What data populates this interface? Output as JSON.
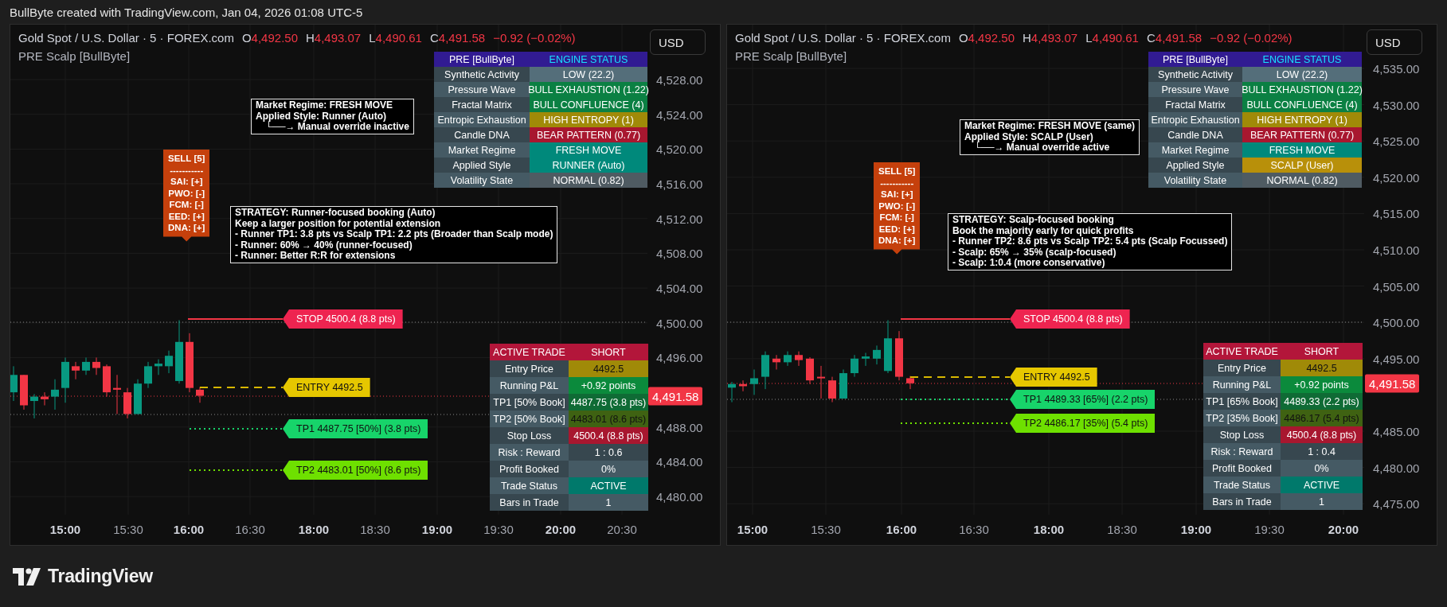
{
  "top_bar": {
    "caption": "BullByte created with TradingView.com, Jan 04, 2026 01:08 UTC-5"
  },
  "charts": [
    {
      "header": {
        "symbol": "Gold Spot / U.S. Dollar · 5 · FOREX.com",
        "ohlc": [
          {
            "label": "O",
            "value": "4,492.50"
          },
          {
            "label": "H",
            "value": "4,493.07"
          },
          {
            "label": "L",
            "value": "4,490.61"
          },
          {
            "label": "C",
            "value": "4,491.58"
          }
        ],
        "change": "−0.92 (−0.02%)",
        "indicator": "PRE Scalp [BullByte]"
      },
      "currency": "USD",
      "price_axis": [
        "4,528.00",
        "4,524.00",
        "4,520.00",
        "4,516.00",
        "4,512.00",
        "4,508.00",
        "4,504.00",
        "4,500.00",
        "4,496.00",
        "4,488.00",
        "4,484.00",
        "4,480.00"
      ],
      "last_price": "4,491.58",
      "time_axis": [
        {
          "label": "15:00",
          "major": true
        },
        {
          "label": "15:30",
          "major": false
        },
        {
          "label": "16:00",
          "major": true
        },
        {
          "label": "16:30",
          "major": false
        },
        {
          "label": "18:00",
          "major": true
        },
        {
          "label": "18:30",
          "major": false
        },
        {
          "label": "19:00",
          "major": true
        },
        {
          "label": "19:30",
          "major": false
        },
        {
          "label": "20:00",
          "major": true
        },
        {
          "label": "20:30",
          "major": false
        }
      ],
      "regime_note": [
        "Market Regime: FRESH MOVE",
        "Applied Style: Runner (Auto)",
        "└──→ Manual override inactive"
      ],
      "signal": {
        "title": "SELL [5]",
        "divider": "-----------",
        "items": [
          "SAI: [+]",
          "PWO: [-]",
          "FCM: [-]",
          "EED: [+]",
          "DNA: [+]"
        ]
      },
      "strategy": [
        "STRATEGY: Runner-focused booking (Auto)",
        "Keep a larger position for potential extension",
        "- Runner TP1: 3.8 pts vs Scalp TP1: 2.2 pts (Broader than Scalp mode)",
        "- Runner: 60% → 40% (runner-focused)",
        "- Runner: Better R:R for extensions"
      ],
      "levels": [
        {
          "kind": "stop",
          "label": "STOP 4500.4 (8.8 pts)"
        },
        {
          "kind": "entry",
          "label": "ENTRY 4492.5"
        },
        {
          "kind": "tp1",
          "label": "TP1 4487.75 [50%] (3.8 pts)"
        },
        {
          "kind": "tp2",
          "label": "TP2 4483.01 [50%] (8.6 pts)"
        }
      ],
      "engine_table": {
        "header": [
          "PRE [BullByte]",
          "ENGINE STATUS"
        ],
        "rows": [
          {
            "label": "Synthetic Activity",
            "value": "LOW (22.2)",
            "color": "#546e7a"
          },
          {
            "label": "Pressure Wave",
            "value": "BULL EXHAUSTION (1.22)",
            "color": "#0b8043"
          },
          {
            "label": "Fractal Matrix",
            "value": "BULL CONFLUENCE (4)",
            "color": "#0b8043"
          },
          {
            "label": "Entropic Exhaustion",
            "value": "HIGH ENTROPY (1)",
            "color": "#a08a08"
          },
          {
            "label": "Candle DNA",
            "value": "BEAR PATTERN (0.77)",
            "color": "#a8172f"
          },
          {
            "label": "Market Regime",
            "value": "FRESH MOVE",
            "color": "#00897b"
          },
          {
            "label": "Applied Style",
            "value": "RUNNER (Auto)",
            "color": "#00897b"
          },
          {
            "label": "Volatility State",
            "value": "NORMAL (0.82)",
            "color": "#4f5b62"
          }
        ]
      },
      "trade_table": {
        "header": [
          "ACTIVE TRADE",
          "SHORT"
        ],
        "rows": [
          {
            "label": "Entry Price",
            "value": "4492.5",
            "color": "#a08a08",
            "dark_text": true
          },
          {
            "label": "Running P&L",
            "value": "+0.92 points",
            "color": "#0b8a3c",
            "dark_text": false
          },
          {
            "label": "TP1 [50% Book]",
            "value": "4487.75 (3.8 pts)",
            "color": "#0f6b35",
            "dark_text": false
          },
          {
            "label": "TP2 [50% Book]",
            "value": "4483.01 (8.6 pts)",
            "color": "#3f6212",
            "dark_text": true
          },
          {
            "label": "Stop Loss",
            "value": "4500.4 (8.8 pts)",
            "color": "#a8172f",
            "dark_text": false
          },
          {
            "label": "Risk : Reward",
            "value": "1 : 0.6",
            "color": "#37474f",
            "dark_text": false
          },
          {
            "label": "Profit Booked",
            "value": "0%",
            "color": "#455a64",
            "dark_text": false
          },
          {
            "label": "Trade Status",
            "value": "ACTIVE",
            "color": "#00796b",
            "dark_text": false
          },
          {
            "label": "Bars in Trade",
            "value": "1",
            "color": "#455a64",
            "dark_text": false
          }
        ]
      }
    },
    {
      "header": {
        "symbol": "Gold Spot / U.S. Dollar · 5 · FOREX.com",
        "ohlc": [
          {
            "label": "O",
            "value": "4,492.50"
          },
          {
            "label": "H",
            "value": "4,493.07"
          },
          {
            "label": "L",
            "value": "4,490.61"
          },
          {
            "label": "C",
            "value": "4,491.58"
          }
        ],
        "change": "−0.92 (−0.02%)",
        "indicator": "PRE Scalp [BullByte]"
      },
      "currency": "USD",
      "price_axis": [
        "4,535.00",
        "4,530.00",
        "4,525.00",
        "4,520.00",
        "4,515.00",
        "4,510.00",
        "4,505.00",
        "4,500.00",
        "4,495.00",
        "4,485.00",
        "4,480.00",
        "4,475.00"
      ],
      "last_price": "4,491.58",
      "time_axis": [
        {
          "label": "15:00",
          "major": true
        },
        {
          "label": "15:30",
          "major": false
        },
        {
          "label": "16:00",
          "major": true
        },
        {
          "label": "16:30",
          "major": false
        },
        {
          "label": "18:00",
          "major": true
        },
        {
          "label": "18:30",
          "major": false
        },
        {
          "label": "19:00",
          "major": true
        },
        {
          "label": "19:30",
          "major": false
        },
        {
          "label": "20:00",
          "major": true
        }
      ],
      "regime_note": [
        "Market Regime: FRESH MOVE (same)",
        "Applied Style: SCALP (User)",
        "└──→ Manual override active"
      ],
      "signal": {
        "title": "SELL [5]",
        "divider": "-----------",
        "items": [
          "SAI: [+]",
          "PWO: [-]",
          "FCM: [-]",
          "EED: [+]",
          "DNA: [+]"
        ]
      },
      "strategy": [
        "STRATEGY: Scalp-focused booking",
        "Book the majority early for quick profits",
        "- Runner TP2: 8.6 pts vs Scalp TP2: 5.4 pts (Scalp Focussed)",
        "- Scalp: 65% → 35% (scalp-focused)",
        "- Scalp: 1:0.4 (more conservative)"
      ],
      "levels": [
        {
          "kind": "stop",
          "label": "STOP 4500.4 (8.8 pts)"
        },
        {
          "kind": "entry",
          "label": "ENTRY 4492.5"
        },
        {
          "kind": "tp1",
          "label": "TP1 4489.33 [65%] (2.2 pts)"
        },
        {
          "kind": "tp2",
          "label": "TP2 4486.17 [35%] (5.4 pts)"
        }
      ],
      "engine_table": {
        "header": [
          "PRE [BullByte]",
          "ENGINE STATUS"
        ],
        "rows": [
          {
            "label": "Synthetic Activity",
            "value": "LOW (22.2)",
            "color": "#546e7a"
          },
          {
            "label": "Pressure Wave",
            "value": "BULL EXHAUSTION (1.22)",
            "color": "#0b8043"
          },
          {
            "label": "Fractal Matrix",
            "value": "BULL CONFLUENCE (4)",
            "color": "#0b8043"
          },
          {
            "label": "Entropic Exhaustion",
            "value": "HIGH ENTROPY (1)",
            "color": "#a08a08"
          },
          {
            "label": "Candle DNA",
            "value": "BEAR PATTERN (0.77)",
            "color": "#a8172f"
          },
          {
            "label": "Market Regime",
            "value": "FRESH MOVE",
            "color": "#00897b"
          },
          {
            "label": "Applied Style",
            "value": "SCALP (User)",
            "color": "#b8900a"
          },
          {
            "label": "Volatility State",
            "value": "NORMAL (0.82)",
            "color": "#4f5b62"
          }
        ]
      },
      "trade_table": {
        "header": [
          "ACTIVE TRADE",
          "SHORT"
        ],
        "rows": [
          {
            "label": "Entry Price",
            "value": "4492.5",
            "color": "#a08a08",
            "dark_text": true
          },
          {
            "label": "Running P&L",
            "value": "+0.92 points",
            "color": "#0b8a3c",
            "dark_text": false
          },
          {
            "label": "TP1 [65% Book]",
            "value": "4489.33 (2.2 pts)",
            "color": "#0f6b35",
            "dark_text": false
          },
          {
            "label": "TP2 [35% Book]",
            "value": "4486.17 (5.4 pts)",
            "color": "#3f6212",
            "dark_text": true
          },
          {
            "label": "Stop Loss",
            "value": "4500.4 (8.8 pts)",
            "color": "#a8172f",
            "dark_text": false
          },
          {
            "label": "Risk : Reward",
            "value": "1 : 0.4",
            "color": "#37474f",
            "dark_text": false
          },
          {
            "label": "Profit Booked",
            "value": "0%",
            "color": "#455a64",
            "dark_text": false
          },
          {
            "label": "Trade Status",
            "value": "ACTIVE",
            "color": "#00796b",
            "dark_text": false
          },
          {
            "label": "Bars in Trade",
            "value": "1",
            "color": "#455a64",
            "dark_text": false
          }
        ]
      }
    }
  ],
  "footer": {
    "brand": "TradingView"
  }
}
